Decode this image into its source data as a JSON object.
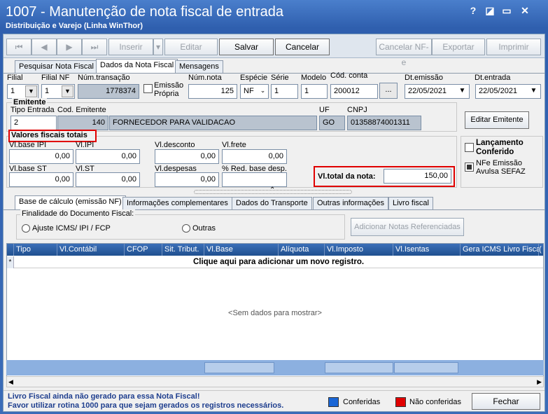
{
  "window": {
    "title": "1007 - Manutenção de nota fiscal de entrada",
    "subtitle": "Distribuição e Varejo (Linha WinThor)",
    "help": "?",
    "restore": "◪",
    "minimize": "▭",
    "close": "✕"
  },
  "toolbar": {
    "first": "⏮",
    "prev": "◀",
    "next": "▶",
    "last": "⏭",
    "inserir": "Inserir",
    "editar": "Editar",
    "salvar": "Salvar",
    "cancelar": "Cancelar",
    "cancelar_nfe": "Cancelar NF-e",
    "exportar": "Exportar",
    "imprimir": "Imprimir"
  },
  "tabs_top": [
    "Pesquisar Nota Fiscal",
    "Dados da Nota Fiscal",
    "Mensagens"
  ],
  "labels": {
    "filial": "Filial",
    "filial_nf": "Filial NF",
    "num_transacao": "Núm.transação",
    "emissao_propria": "Emissão Própria",
    "num_nota": "Núm.nota",
    "especie": "Espécie",
    "serie": "Série",
    "modelo": "Modelo",
    "cod_conta": "Cód. conta",
    "dt_emissao": "Dt.emissão",
    "dt_entrada": "Dt.entrada",
    "emitente": "Emitente",
    "tipo_entrada": "Tipo Entrada",
    "cod_emitente": "Cod. Emitente",
    "uf": "UF",
    "cnpj": "CNPJ",
    "valores_fiscais": "Valores fiscais totais",
    "vl_base_ipi": "Vl.base IPI",
    "vl_ipi": "Vl.IPI",
    "vl_desconto": "Vl.desconto",
    "vl_frete": "Vl.frete",
    "vl_base_st": "Vl.base ST",
    "vl_st": "Vl.ST",
    "vl_despesas": "Vl.despesas",
    "red_base": "% Red. base desp.",
    "vl_total": "Vl.total da nota:",
    "lancamento": "Lançamento Conferido",
    "nfe_avulsa": "NFe Emissão Avulsa SEFAZ",
    "editar_emitente": "Editar Emitente"
  },
  "values": {
    "filial": "1",
    "filial_nf": "1",
    "num_transacao": "1778374",
    "num_nota": "125",
    "especie": "NF",
    "serie": "1",
    "modelo": "1",
    "cod_conta": "200012",
    "cod_conta_btn": "...",
    "dt_emissao": "22/05/2021",
    "dt_entrada": "22/05/2021",
    "tipo_entrada": "2",
    "cod_emitente": "140",
    "emitente_nome": "FORNECEDOR PARA VALIDACAO",
    "uf": "GO",
    "cnpj": "01358874001311",
    "vl_base_ipi": "0,00",
    "vl_ipi": "0,00",
    "vl_desconto": "0,00",
    "vl_frete": "0,00",
    "vl_base_st": "0,00",
    "vl_st": "0,00",
    "vl_despesas": "0,00",
    "red_base": "",
    "vl_total": "150,00"
  },
  "tabs_bottom": [
    "Base de cálculo (emissão NF)",
    "Informações complementares",
    "Dados do Transporte",
    "Outras informações",
    "Livro fiscal"
  ],
  "finalidade": {
    "title": "Finalidade do Documento Fiscal:",
    "opt1": "Ajuste ICMS/ IPI / FCP",
    "opt2": "Outras",
    "btn": "Adicionar Notas Referenciadas"
  },
  "grid": {
    "columns": [
      "Tipo",
      "Vl.Contábil",
      "CFOP",
      "Sit. Tribut.",
      "Vl.Base",
      "Alíquota",
      "Vl.Imposto",
      "Vl.Isentas",
      "Gera ICMS Livro Fiscal",
      "("
    ],
    "new_row": "Clique aqui para adicionar um novo registro.",
    "empty": "<Sem dados para mostrar>"
  },
  "status": {
    "line1": "Livro Fiscal ainda não gerado para essa Nota Fiscal!",
    "line2": "Favor utilizar rotina 1000 para que sejam gerados os registros necessários.",
    "conferidas": "Conferidas",
    "nao_conferidas": "Não conferidas",
    "fechar": "Fechar"
  },
  "colors": {
    "conferidas": "#1a66d6",
    "nao_conferidas": "#e00000",
    "highlight": "#e00000"
  }
}
